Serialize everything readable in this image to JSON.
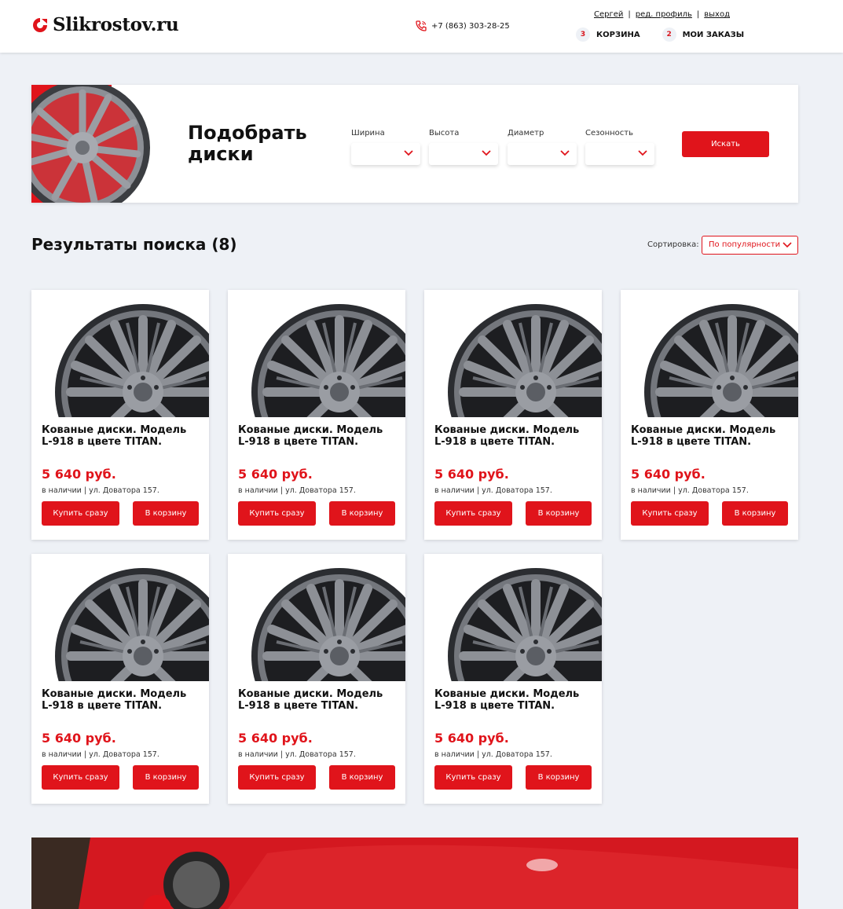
{
  "header": {
    "logo_text": "Slikrostov.ru",
    "phone": "+7 (863) 303-28-25",
    "user_links": {
      "user": "Сергей",
      "edit_profile": "ред. профиль",
      "logout": "выход"
    },
    "separator": "|",
    "cart": {
      "count": "3",
      "label": "КОРЗИНА"
    },
    "orders": {
      "count": "2",
      "label": "МОИ ЗАКАЗЫ"
    }
  },
  "filter": {
    "title": "Подобрать диски",
    "fields": [
      {
        "label": "Ширина",
        "value": ""
      },
      {
        "label": "Высота",
        "value": ""
      },
      {
        "label": "Диаметр",
        "value": ""
      },
      {
        "label": "Сезонность",
        "value": ""
      }
    ],
    "search_label": "Искать"
  },
  "results": {
    "title": "Результаты поиска (8)",
    "sort_label": "Сортировка:",
    "sort_value": "По популярности"
  },
  "products": [
    {
      "title": "Кованые диски. Модель L-918 в цвете TITAN.",
      "price": "5 640 руб.",
      "stock": "в наличии | ул. Доватора 157.",
      "buy_label": "Купить сразу",
      "cart_label": "В корзину"
    },
    {
      "title": "Кованые диски. Модель L-918 в цвете TITAN.",
      "price": "5 640 руб.",
      "stock": "в наличии | ул. Доватора 157.",
      "buy_label": "Купить сразу",
      "cart_label": "В корзину"
    },
    {
      "title": "Кованые диски. Модель L-918 в цвете TITAN.",
      "price": "5 640 руб.",
      "stock": "в наличии | ул. Доватора 157.",
      "buy_label": "Купить сразу",
      "cart_label": "В корзину"
    },
    {
      "title": "Кованые диски. Модель L-918 в цвете TITAN.",
      "price": "5 640 руб.",
      "stock": "в наличии | ул. Доватора 157.",
      "buy_label": "Купить сразу",
      "cart_label": "В корзину"
    },
    {
      "title": "Кованые диски. Модель L-918 в цвете TITAN.",
      "price": "5 640 руб.",
      "stock": "в наличии | ул. Доватора 157.",
      "buy_label": "Купить сразу",
      "cart_label": "В корзину"
    },
    {
      "title": "Кованые диски. Модель L-918 в цвете TITAN.",
      "price": "5 640 руб.",
      "stock": "в наличии | ул. Доватора 157.",
      "buy_label": "Купить сразу",
      "cart_label": "В корзину"
    },
    {
      "title": "Кованые диски. Модель L-918 в цвете TITAN.",
      "price": "5 640 руб.",
      "stock": "в наличии | ул. Доватора 157.",
      "buy_label": "Купить сразу",
      "cart_label": "В корзину"
    }
  ],
  "colors": {
    "accent": "#e0141b",
    "background": "#eef1f6"
  },
  "icons": {
    "logo": "logo-mark-icon",
    "phone": "phone-icon",
    "dropdown": "chevron-down-icon",
    "product": "wheel-image"
  }
}
